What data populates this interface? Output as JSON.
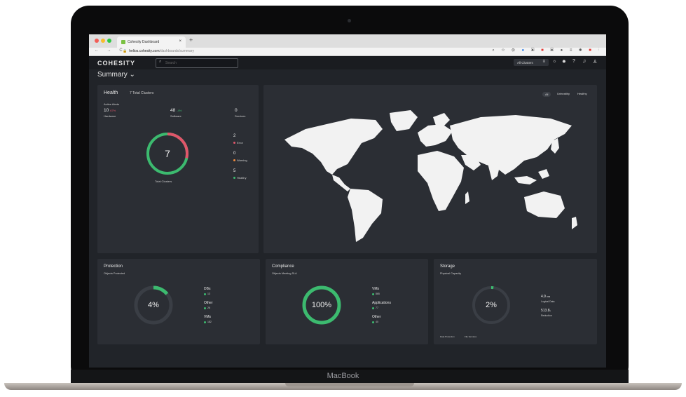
{
  "device": {
    "brand": "MacBook"
  },
  "browser": {
    "tab_title": "Cohesity Dashboard",
    "tab_close": "×",
    "new_tab": "+",
    "nav_buttons": "← → C",
    "url_host": "helios.cohesity.com",
    "url_path": "/dashboards/summary",
    "lock_icon": "🔒"
  },
  "app": {
    "logo": "COHESITY",
    "search_placeholder": "Search",
    "cluster_selector": "All Clusters",
    "page_title": "Summary ⌄"
  },
  "health": {
    "title": "Health",
    "subtitle": "7 Total Clusters",
    "active_alerts_label": "Active Alerts",
    "hardware": {
      "value": "10",
      "delta": "67%",
      "label": "Hardware"
    },
    "software": {
      "value": "48",
      "delta": "-4%",
      "label": "Software"
    },
    "services": {
      "value": "0",
      "label": "Services"
    },
    "center_value": "7",
    "center_label": "Total Clusters",
    "error": {
      "count": "2",
      "label": "Error",
      "color": "#e0566a"
    },
    "warning": {
      "count": "0",
      "label": "Warning",
      "color": "#f08a3c"
    },
    "healthy": {
      "count": "5",
      "label": "Healthy",
      "color": "#3cba6f"
    }
  },
  "map": {
    "filters": [
      "All",
      "Unhealthy",
      "Healthy"
    ]
  },
  "protection": {
    "title": "Protection",
    "subtitle": "Objects Protected",
    "percent": "4%",
    "items": [
      {
        "label": "DBs",
        "value": "13"
      },
      {
        "label": "Other",
        "value": "26"
      },
      {
        "label": "VMs",
        "value": "182"
      }
    ]
  },
  "compliance": {
    "title": "Compliance",
    "subtitle": "Objects Meeting SLA",
    "percent": "100%",
    "items": [
      {
        "label": "VMs",
        "value": "865"
      },
      {
        "label": "Applications",
        "value": "77"
      },
      {
        "label": "Other",
        "value": "40"
      }
    ]
  },
  "storage": {
    "title": "Storage",
    "subtitle": "Physical Capacity",
    "percent": "2%",
    "logical_value": "4.9",
    "logical_unit": "PiB",
    "logical_label": "Logical Data",
    "reduction_value": "513.8",
    "reduction_unit": "x",
    "reduction_label": "Reduction",
    "footer_a": "Data Protection",
    "footer_b": "File Services"
  },
  "colors": {
    "accent_green": "#3cba6f",
    "error_red": "#e0566a",
    "warning_orange": "#f08a3c",
    "panel": "#2b2e34"
  }
}
